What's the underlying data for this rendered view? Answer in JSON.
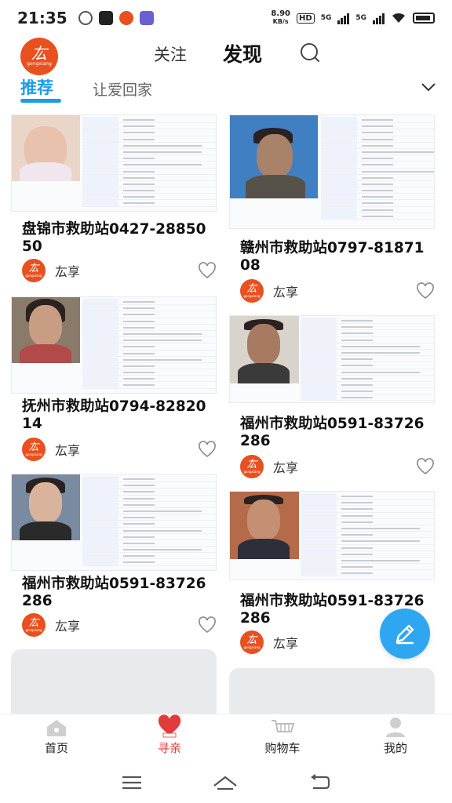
{
  "status_bar": {
    "time": "21:35",
    "net_speed_value": "8.90",
    "net_speed_unit": "KB/s",
    "hd_badge": "HD",
    "sim1": "5G",
    "sim2": "5G"
  },
  "header": {
    "logo_text": "厷",
    "logo_sub": "gongxiang",
    "follow_tab": "关注",
    "discover_tab": "发现"
  },
  "category_tabs": [
    {
      "label": "推荐",
      "active": true
    },
    {
      "label": "让爱回家",
      "active": false
    }
  ],
  "feed": {
    "left_column": [
      {
        "title": "盘锦市救助站0427-2885050",
        "author": "厷享",
        "photo": "baby"
      },
      {
        "title": "抚州市救助站0794-8282014",
        "author": "厷享",
        "photo": "woman"
      },
      {
        "title": "福州市救助站0591-83726286",
        "author": "厷享",
        "photo": "man"
      }
    ],
    "right_column": [
      {
        "title": "赣州市救助站0797-8187108",
        "author": "厷享",
        "photo": "man"
      },
      {
        "title": "福州市救助站0591-83726286",
        "author": "厷享",
        "photo": "man"
      },
      {
        "title": "福州市救助站0591-83726286",
        "author": "厷享",
        "photo": "man"
      }
    ]
  },
  "bottom_nav": [
    {
      "label": "首页",
      "icon": "home-icon",
      "active": false
    },
    {
      "label": "寻亲",
      "icon": "love-home-icon",
      "active": true
    },
    {
      "label": "购物车",
      "icon": "cart-icon",
      "active": false
    },
    {
      "label": "我的",
      "icon": "profile-icon",
      "active": false
    }
  ],
  "colors": {
    "accent": "#1e9be9",
    "brand_orange": "#e8501f",
    "active_nav": "#e23b3b",
    "fab": "#2ea7f0"
  }
}
